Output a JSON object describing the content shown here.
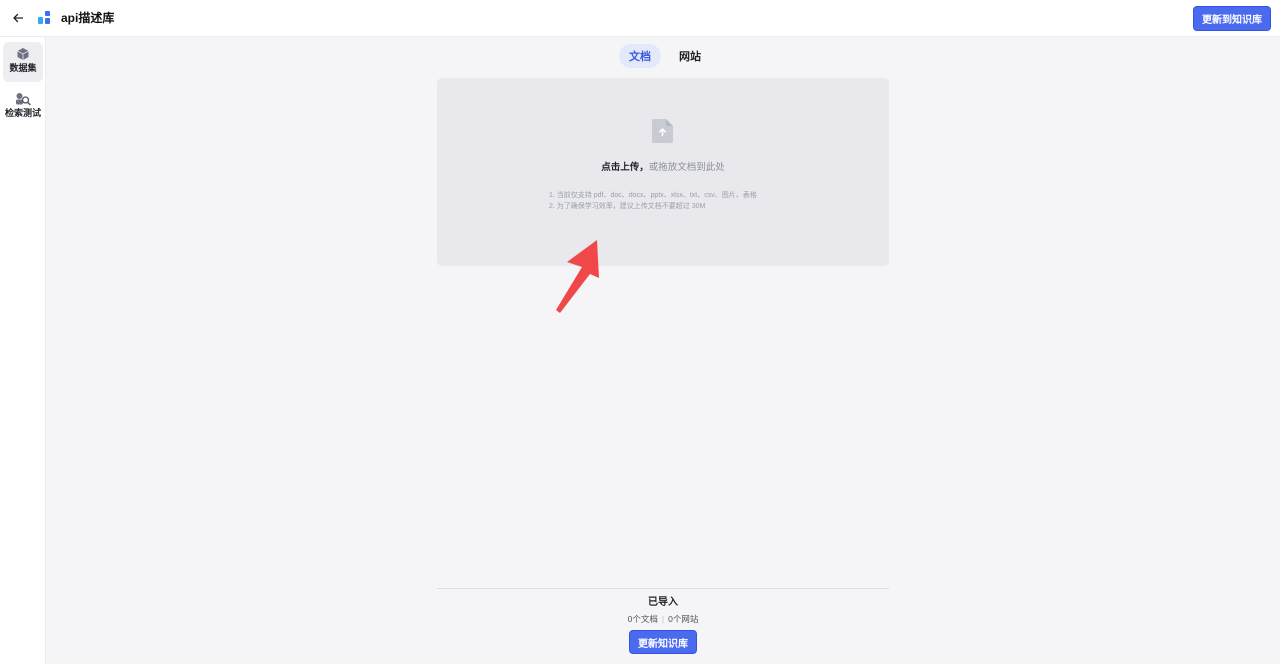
{
  "header": {
    "back_icon": "arrow-left-icon",
    "logo_icon": "app-grid-icon",
    "title": "api描述库",
    "update_button": "更新到知识库",
    "accent_color": "#4a6af0"
  },
  "sidebar": {
    "items": [
      {
        "label": "数据集",
        "icon": "dataset-cube-icon",
        "active": true
      },
      {
        "label": "检索测试",
        "icon": "search-test-icon",
        "active": false
      }
    ]
  },
  "tabs": [
    {
      "label": "文档",
      "active": true
    },
    {
      "label": "网站",
      "active": false
    }
  ],
  "upload": {
    "icon": "file-upload-icon",
    "click_text": "点击上传，",
    "drag_text": "或拖放文档到此处",
    "hints": [
      "1. 当前仅支持 pdf、doc、docx、pptx、xlsx、txt、csv、图片、表格",
      "2. 为了确保学习效率，建议上传文档不要超过 30M"
    ]
  },
  "annotation": {
    "icon": "red-arrow-icon",
    "color": "#f04848"
  },
  "imported": {
    "title": "已导入",
    "documents": "0个文档",
    "websites": "0个网站",
    "update_button": "更新知识库"
  }
}
